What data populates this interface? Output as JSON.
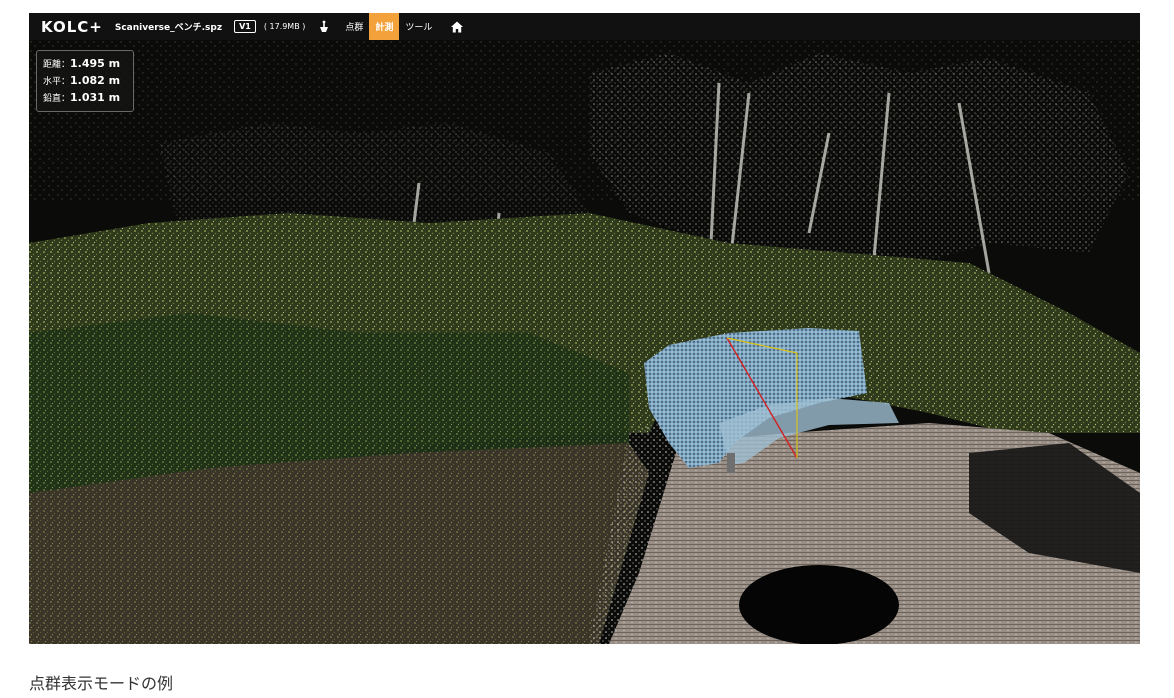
{
  "toolbar": {
    "logo": "KOLC+",
    "file_name": "Scaniverse_ベンチ.spz",
    "version": "V1",
    "file_size": "( 17.9MB )",
    "icons": [
      "layers-icon",
      "home-icon"
    ],
    "menu": [
      "点群",
      "計測",
      "ツール"
    ],
    "active_menu": "計測",
    "accent_color": "#f3a13a"
  },
  "measurement": {
    "distance_label": "距離：",
    "distance_value": "1.495 m",
    "horizontal_label": "水平：",
    "horizontal_value": "1.082 m",
    "vertical_label": "鉛直：",
    "vertical_value": "1.031 m",
    "line_colors": {
      "distance": "#d22020",
      "horizontal": "#d9c21a",
      "vertical": "#d9c21a"
    }
  },
  "caption": "点群表示モードの例"
}
